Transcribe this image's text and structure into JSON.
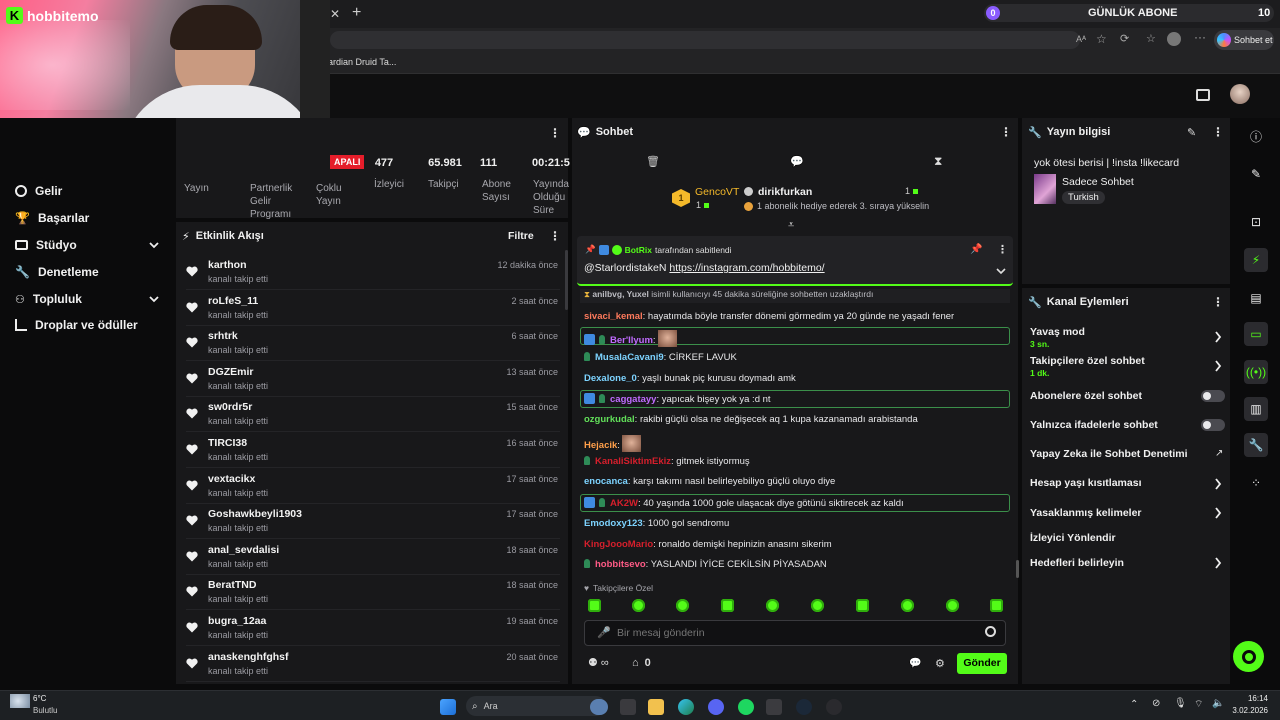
{
  "browser": {
    "bookmark_partial": "ardian Druid Ta...",
    "sub_widget_count": "0",
    "sub_widget_label": "GÜNLÜK ABONE",
    "sub_widget_goal": "10",
    "chat_button_label": "Sohbet et"
  },
  "webcam": {
    "logo_text": "hobbitemo"
  },
  "sidebar": {
    "items": [
      {
        "label": "Gelir"
      },
      {
        "label": "Başarılar"
      },
      {
        "label": "Stüdyo"
      },
      {
        "label": "Denetleme"
      },
      {
        "label": "Topluluk"
      },
      {
        "label": "Droplar ve ödüller"
      }
    ]
  },
  "stats": {
    "live_badge": "APALI",
    "items": [
      {
        "value": "",
        "label": "Yayın"
      },
      {
        "value": "",
        "label": "Partnerlik Gelir Programı"
      },
      {
        "value": "",
        "label": "Çoklu Yayın"
      },
      {
        "value": "477",
        "label": "İzleyici"
      },
      {
        "value": "65.981",
        "label": "Takipçi"
      },
      {
        "value": "111",
        "label": "Abone Sayısı"
      },
      {
        "value": "00:21:5",
        "label": "Yayında Olduğu Süre"
      }
    ]
  },
  "activity": {
    "title": "Etkinlik Akışı",
    "filter_label": "Filtre",
    "rows": [
      {
        "name": "karthon",
        "sub": "kanalı takip etti",
        "time": "12 dakika önce"
      },
      {
        "name": "roLfeS_11",
        "sub": "kanalı takip etti",
        "time": "2 saat önce"
      },
      {
        "name": "srhtrk",
        "sub": "kanalı takip etti",
        "time": "6 saat önce"
      },
      {
        "name": "DGZEmir",
        "sub": "kanalı takip etti",
        "time": "13 saat önce"
      },
      {
        "name": "sw0rdr5r",
        "sub": "kanalı takip etti",
        "time": "15 saat önce"
      },
      {
        "name": "TIRCI38",
        "sub": "kanalı takip etti",
        "time": "16 saat önce"
      },
      {
        "name": "vextacikx",
        "sub": "kanalı takip etti",
        "time": "17 saat önce"
      },
      {
        "name": "Goshawkbeyli1903",
        "sub": "kanalı takip etti",
        "time": "17 saat önce"
      },
      {
        "name": "anal_sevdalisi",
        "sub": "kanalı takip etti",
        "time": "18 saat önce"
      },
      {
        "name": "BeratTND",
        "sub": "kanalı takip etti",
        "time": "18 saat önce"
      },
      {
        "name": "bugra_12aa",
        "sub": "kanalı takip etti",
        "time": "19 saat önce"
      },
      {
        "name": "anaskenghfghsf",
        "sub": "kanalı takip etti",
        "time": "20 saat önce"
      }
    ]
  },
  "chat": {
    "title": "Sohbet",
    "leader1_name": "GencoVT",
    "leader1_rank": "1",
    "leader1_count": "1",
    "leader2_name": "dirikfurkan",
    "leader2_count": "1",
    "leader2_desc": "1 abonelik hediye ederek 3. sıraya yükselin",
    "pinned_by_user": "BotRix",
    "pinned_by_text": "tarafından sabitlendi",
    "pinned_mention": "@StarlordistakeN",
    "pinned_link": "https://instagram.com/hobbitemo/",
    "timeout_users": "anilbvg, Yuxel",
    "timeout_text": "isimli kullanıcıyı 45 dakika süreliğine sohbetten uzaklaştırdı",
    "messages": [
      {
        "user": "sivaci_kemal",
        "color": "#ff7a5c",
        "text": ": hayatımda böyle transfer dönemi görmedim ya 20 günde ne yaşadı fener"
      },
      {
        "user": "Ber'Ilyum",
        "color": "#c06bff",
        "text": ":"
      },
      {
        "user": "MusalaCavani9",
        "color": "#7dd3ff",
        "text": ": CİRKEF LAVUK"
      },
      {
        "user": "Dexalone_0",
        "color": "#7dd3ff",
        "text": ": yaşlı bunak piç kurusu doymadı amk"
      },
      {
        "user": "caggatayy",
        "color": "#c06bff",
        "text": ": yapıcak bişey yok ya :d nt"
      },
      {
        "user": "ozgurkudal",
        "color": "#62e05a",
        "text": ": rakibi güçlü olsa ne değişecek aq 1 kupa kazanamadı arabistanda"
      },
      {
        "user": "Hejacik",
        "color": "#ff9f4a",
        "text": ":"
      },
      {
        "user": "KanaliSiktimEkiz",
        "color": "#d61f2c",
        "text": ": gitmek istiyormuş"
      },
      {
        "user": "enocanca",
        "color": "#7dd3ff",
        "text": ": karşı takımı nasıl belirleyebiliyo güçlü oluyo diye"
      },
      {
        "user": "AK2W",
        "color": "#d61f2c",
        "text": ": 40 yaşında 1000 gole ulaşacak diye götünü siktirecek az kaldı"
      },
      {
        "user": "Emodoxy123",
        "color": "#7dd3ff",
        "text": ": 1000 gol sendromu"
      },
      {
        "user": "KingJoooMario",
        "color": "#d61f2c",
        "text": ": ronaldo demişki hepinizin anasını sikerim"
      },
      {
        "user": "hobbitsevo",
        "color": "#ff5b86",
        "text": ": YASLANDI İYİCE CEKİLSİN PİYASADAN"
      }
    ],
    "followers_only_label": "Takipçilere Özel",
    "input_placeholder": "Bir mesaj gönderin",
    "link_count": "0",
    "send_label": "Gönder"
  },
  "stream_info": {
    "title": "Yayın bilgisi",
    "stream_title": "yok ötesi berisi | !insta !likecard",
    "category": "Sadece Sohbet",
    "tag": "Turkish"
  },
  "channel_actions": {
    "title": "Kanal Eylemleri",
    "slow_mode_label": "Yavaş mod",
    "slow_mode_value": "3 sn.",
    "followers_chat_label": "Takipçilere özel sohbet",
    "followers_chat_value": "1 dk.",
    "subs_chat_label": "Abonelere özel sohbet",
    "emote_chat_label": "Yalnızca ifadelerle sohbet",
    "ai_mod_label": "Yapay Zeka ile Sohbet Denetimi",
    "age_label": "Hesap yaşı kısıtlaması",
    "banned_words_label": "Yasaklanmış kelimeler",
    "raid_label": "İzleyici Yönlendir",
    "goals_label": "Hedefleri belirleyin"
  },
  "taskbar": {
    "weather_temp": "6°C",
    "weather_desc": "Bulutlu",
    "search_label": "Ara",
    "time": "16:14",
    "date": "3.02.2026"
  }
}
